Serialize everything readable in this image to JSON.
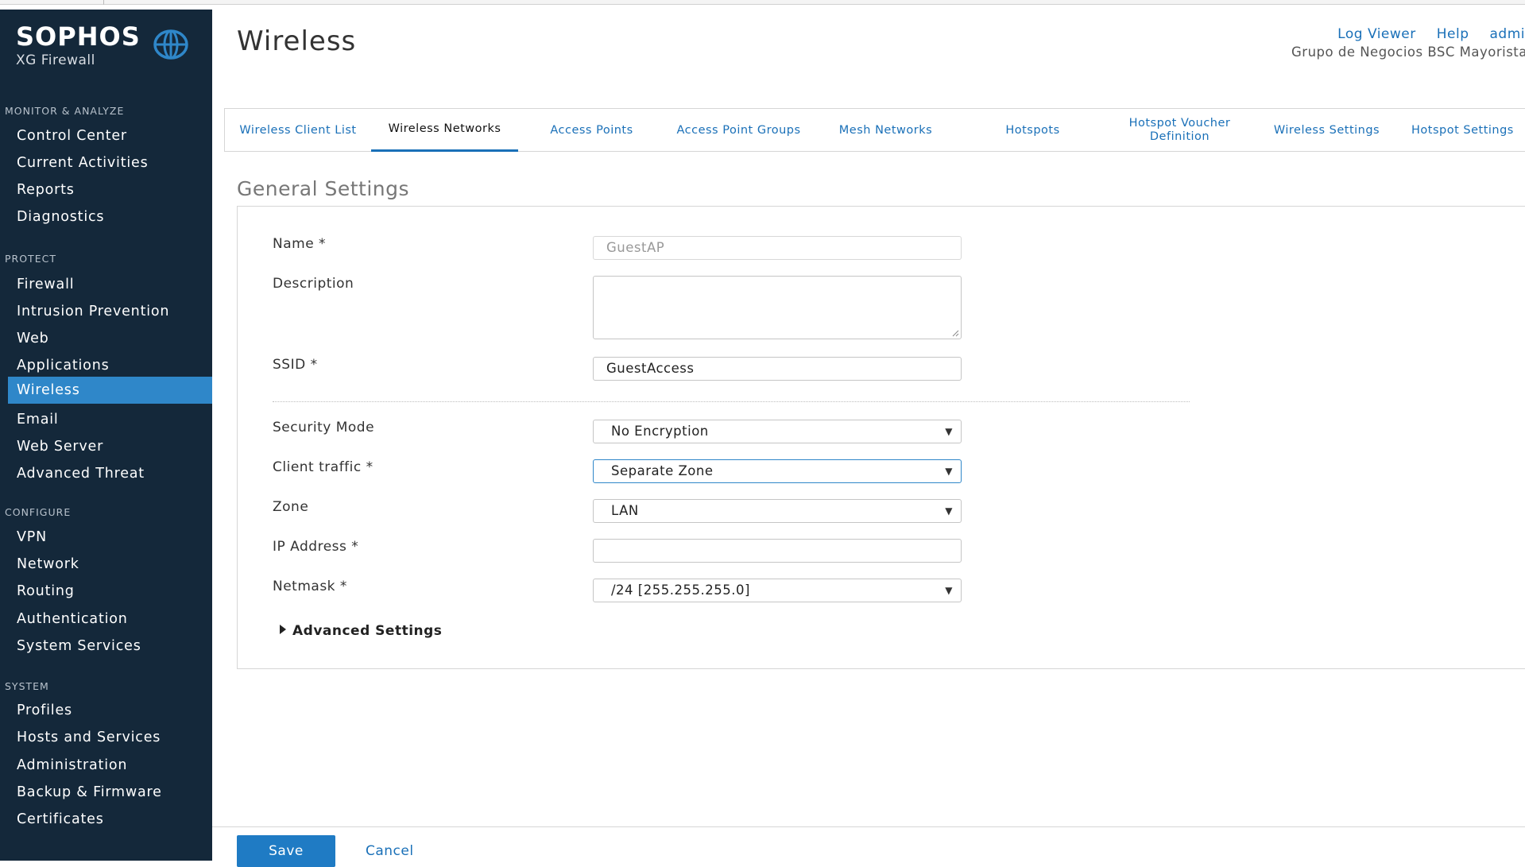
{
  "brand": {
    "name": "SOPHOS",
    "product": "XG Firewall"
  },
  "sidebar": {
    "sections": [
      {
        "title": "MONITOR & ANALYZE",
        "items": [
          "Control Center",
          "Current Activities",
          "Reports",
          "Diagnostics"
        ]
      },
      {
        "title": "PROTECT",
        "items": [
          "Firewall",
          "Intrusion Prevention",
          "Web",
          "Applications",
          "Wireless",
          "Email",
          "Web Server",
          "Advanced Threat"
        ]
      },
      {
        "title": "CONFIGURE",
        "items": [
          "VPN",
          "Network",
          "Routing",
          "Authentication",
          "System Services"
        ]
      },
      {
        "title": "SYSTEM",
        "items": [
          "Profiles",
          "Hosts and Services",
          "Administration",
          "Backup & Firmware",
          "Certificates"
        ]
      }
    ],
    "active_item": "Wireless"
  },
  "header": {
    "title": "Wireless",
    "links": {
      "log_viewer": "Log Viewer",
      "help": "Help",
      "user": "admi"
    },
    "org": "Grupo de Negocios BSC Mayorista"
  },
  "tabs": [
    {
      "label": "Wireless Client List"
    },
    {
      "label": "Wireless Networks"
    },
    {
      "label": "Access Points"
    },
    {
      "label": "Access Point Groups"
    },
    {
      "label": "Mesh Networks"
    },
    {
      "label": "Hotspots"
    },
    {
      "label": "Hotspot Voucher Definition"
    },
    {
      "label": "Wireless Settings"
    },
    {
      "label": "Hotspot Settings"
    }
  ],
  "active_tab": "Wireless Networks",
  "form": {
    "heading": "General Settings",
    "name": {
      "label": "Name *",
      "value": "GuestAP"
    },
    "description": {
      "label": "Description",
      "value": ""
    },
    "ssid": {
      "label": "SSID *",
      "value": "GuestAccess"
    },
    "security_mode": {
      "label": "Security Mode",
      "value": "No Encryption"
    },
    "client_traffic": {
      "label": "Client traffic *",
      "value": "Separate Zone"
    },
    "zone": {
      "label": "Zone",
      "value": "LAN"
    },
    "ip_address": {
      "label": "IP Address *",
      "value": ""
    },
    "netmask": {
      "label": "Netmask *",
      "value": "/24 [255.255.255.0]"
    },
    "advanced": "Advanced Settings"
  },
  "footer": {
    "save": "Save",
    "cancel": "Cancel"
  },
  "colors": {
    "sidebar_bg": "#14283a",
    "accent": "#2f87c9",
    "link": "#1a70b8"
  }
}
